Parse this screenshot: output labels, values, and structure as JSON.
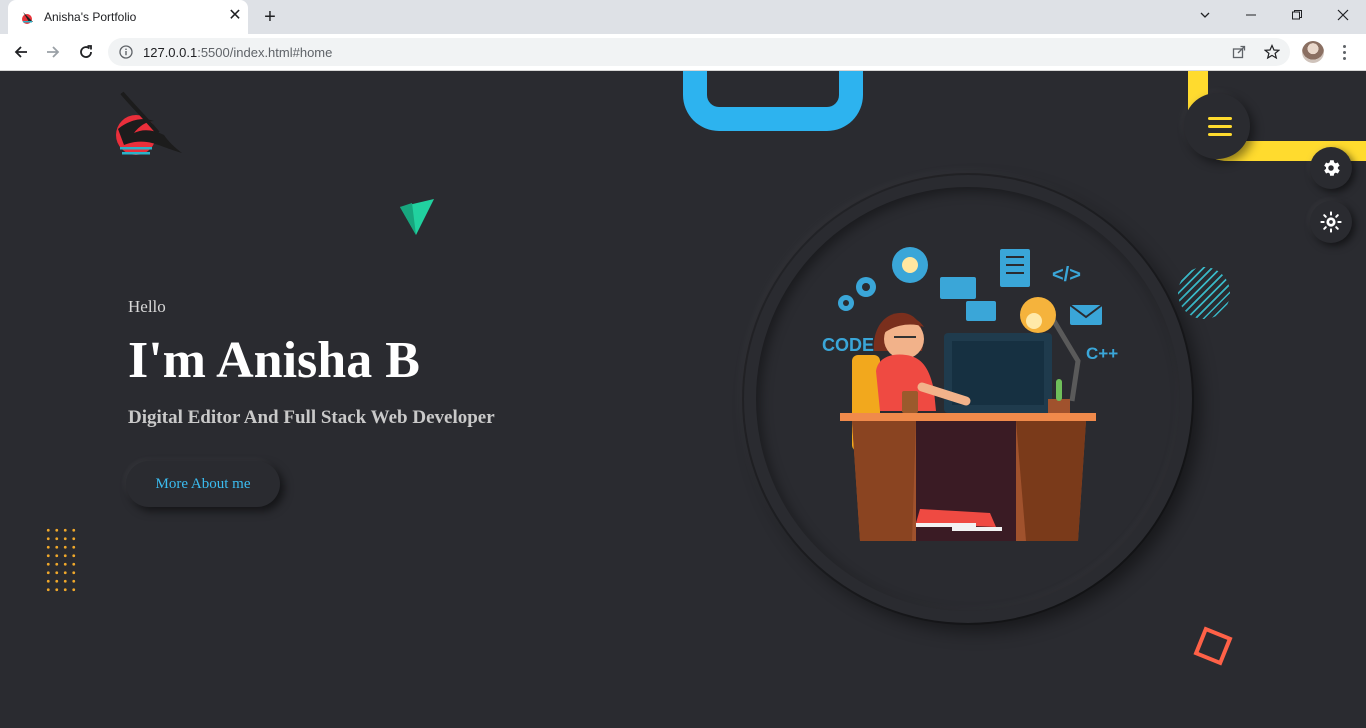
{
  "browser": {
    "tab_title": "Anisha's Portfolio",
    "url_host": "127.0.0.1",
    "url_rest": ":5500/index.html#home",
    "tab_close": "✕",
    "new_tab": "+"
  },
  "hero": {
    "greeting": "Hello",
    "name": "I'm Anisha B",
    "role": "Digital Editor And Full Stack Web Developer",
    "cta_label": "More About me"
  },
  "illustration": {
    "code_label": "CODE",
    "cpp_label": "C++",
    "tag_label": "</>"
  },
  "colors": {
    "background": "#2a2b30",
    "accent_blue": "#2db3ef",
    "accent_yellow": "#ffdb2e",
    "accent_red": "#ff6147",
    "accent_green": "#21d19f"
  },
  "icons": {
    "settings": "gear-icon",
    "theme": "sun-icon",
    "menu": "hamburger-icon"
  }
}
